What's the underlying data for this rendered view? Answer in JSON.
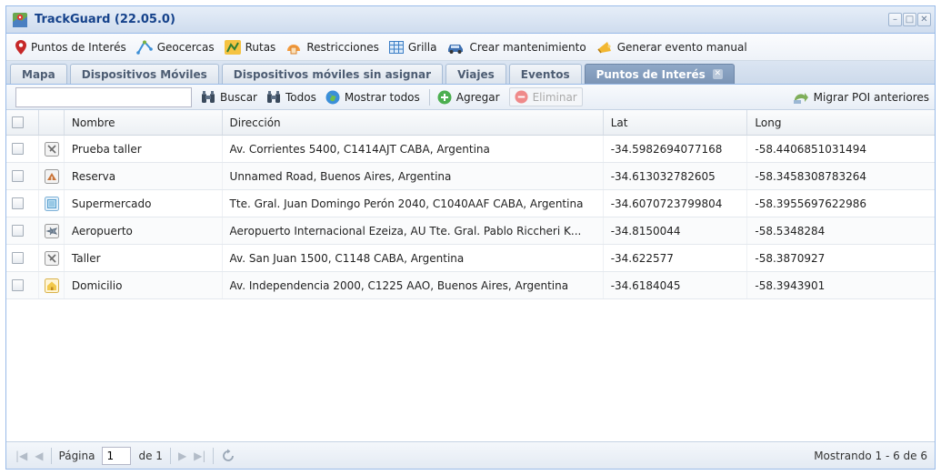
{
  "window": {
    "title": "TrackGuard (22.05.0)"
  },
  "toolbar": {
    "items": [
      {
        "label": "Puntos de Interés",
        "icon": "map-pin-icon"
      },
      {
        "label": "Geocercas",
        "icon": "geofence-icon"
      },
      {
        "label": "Rutas",
        "icon": "route-icon"
      },
      {
        "label": "Restricciones",
        "icon": "restriction-icon"
      },
      {
        "label": "Grilla",
        "icon": "grid-icon"
      },
      {
        "label": "Crear mantenimiento",
        "icon": "car-icon"
      },
      {
        "label": "Generar evento manual",
        "icon": "megaphone-icon"
      }
    ]
  },
  "tabs": [
    {
      "label": "Mapa",
      "active": false
    },
    {
      "label": "Dispositivos Móviles",
      "active": false
    },
    {
      "label": "Dispositivos móviles sin asignar",
      "active": false
    },
    {
      "label": "Viajes",
      "active": false
    },
    {
      "label": "Eventos",
      "active": false
    },
    {
      "label": "Puntos de Interés",
      "active": true
    }
  ],
  "gridtoolbar": {
    "search_value": "",
    "buscar": "Buscar",
    "todos": "Todos",
    "mostrar_todos": "Mostrar todos",
    "agregar": "Agregar",
    "eliminar": "Eliminar",
    "migrar": "Migrar POI anteriores"
  },
  "columns": {
    "nombre": "Nombre",
    "direccion": "Dirección",
    "lat": "Lat",
    "long": "Long"
  },
  "rows": [
    {
      "icon": "workshop-icon",
      "nombre": "Prueba taller",
      "direccion": "Av. Corrientes 5400, C1414AJT CABA, Argentina",
      "lat": "-34.5982694077168",
      "long": "-58.4406851031494"
    },
    {
      "icon": "camping-icon",
      "nombre": "Reserva",
      "direccion": "Unnamed Road, Buenos Aires, Argentina",
      "lat": "-34.613032782605",
      "long": "-58.3458308783264"
    },
    {
      "icon": "supermarket-icon",
      "nombre": "Supermercado",
      "direccion": "Tte. Gral. Juan Domingo Perón 2040, C1040AAF CABA, Argentina",
      "lat": "-34.6070723799804",
      "long": "-58.3955697622986"
    },
    {
      "icon": "airport-icon",
      "nombre": "Aeropuerto",
      "direccion": "Aeropuerto Internacional Ezeiza, AU Tte. Gral. Pablo Riccheri K...",
      "lat": "-34.8150044",
      "long": "-58.5348284"
    },
    {
      "icon": "workshop-icon",
      "nombre": "Taller",
      "direccion": "Av. San Juan 1500, C1148 CABA, Argentina",
      "lat": "-34.622577",
      "long": "-58.3870927"
    },
    {
      "icon": "home-icon",
      "nombre": "Domicilio",
      "direccion": "Av. Independencia 2000, C1225 AAO, Buenos Aires, Argentina",
      "lat": "-34.6184045",
      "long": "-58.3943901"
    }
  ],
  "paging": {
    "page_label": "Página",
    "page_value": "1",
    "of_label": "de 1",
    "info": "Mostrando 1 - 6 de 6"
  }
}
